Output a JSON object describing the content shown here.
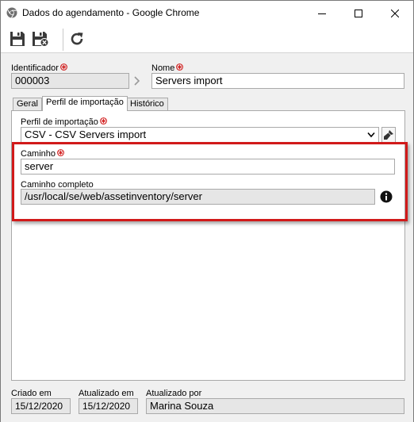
{
  "window": {
    "title": "Dados do agendamento - Google Chrome"
  },
  "toolbar": {
    "buttons": [
      {
        "name": "save-icon"
      },
      {
        "name": "save-close-icon"
      },
      {
        "name": "refresh-icon"
      }
    ]
  },
  "header": {
    "identificador_label": "Identificador",
    "identificador_value": "000003",
    "nome_label": "Nome",
    "nome_value": "Servers import"
  },
  "tabs": [
    {
      "label": "Geral",
      "active": false
    },
    {
      "label": "Perfil de importação",
      "active": true
    },
    {
      "label": "Histórico",
      "active": false
    }
  ],
  "perfil": {
    "perfil_label": "Perfil de importação",
    "perfil_value": "CSV - CSV Servers import",
    "caminho_label": "Caminho",
    "caminho_value": "server",
    "caminho_completo_label": "Caminho completo",
    "caminho_completo_value": "/usr/local/se/web/assetinventory/server"
  },
  "footer": {
    "criado_label": "Criado em",
    "criado_value": "15/12/2020",
    "atualizado_label": "Atualizado em",
    "atualizado_value": "15/12/2020",
    "atualizado_por_label": "Atualizado por",
    "atualizado_por_value": "Marina Souza"
  },
  "colors": {
    "required": "#d11a1a",
    "highlight": "#d11a1a"
  }
}
